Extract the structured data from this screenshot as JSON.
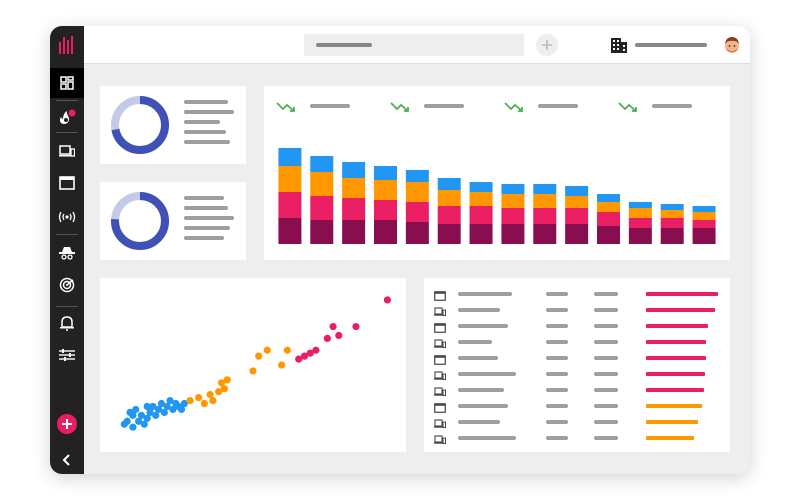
{
  "app": {
    "logo": "bar-logo-icon"
  },
  "colors": {
    "accent": "#e91e63",
    "blue": "#2196f3",
    "orange": "#ff9800",
    "pink": "#e91e63",
    "maroon": "#880e4f",
    "ring": "#3f51b5",
    "trend": "#4caf50"
  },
  "sidebar": {
    "items": [
      {
        "icon": "dashboard-icon",
        "active": true
      },
      {
        "icon": "fire-icon",
        "badge": true
      },
      {
        "icon": "devices-icon"
      },
      {
        "icon": "window-icon"
      },
      {
        "icon": "broadcast-icon"
      },
      {
        "icon": "incognito-icon"
      },
      {
        "icon": "radar-icon"
      },
      {
        "icon": "bell-icon"
      },
      {
        "icon": "sliders-icon"
      }
    ],
    "add_icon": "plus-icon",
    "collapse_icon": "chevron-left-icon"
  },
  "topbar": {
    "search_icon": "search-placeholder",
    "add_icon": "plus-icon",
    "org_icon": "building-icon",
    "avatar": "avatar-icon"
  },
  "donuts": [
    {
      "arc_fraction": 0.72
    },
    {
      "arc_fraction": 0.76
    }
  ],
  "trend_icons": [
    "trend-down-icon",
    "trend-down-icon",
    "trend-down-icon",
    "trend-down-icon"
  ],
  "chart_data": [
    {
      "type": "bar",
      "stacked": true,
      "categories": [
        "",
        "",
        "",
        "",
        "",
        "",
        "",
        "",
        "",
        "",
        "",
        "",
        "",
        ""
      ],
      "series": [
        {
          "color": "#880e4f",
          "values": [
            26,
            24,
            24,
            24,
            22,
            20,
            20,
            20,
            20,
            20,
            18,
            16,
            16,
            16
          ]
        },
        {
          "color": "#e91e63",
          "values": [
            26,
            24,
            22,
            20,
            20,
            18,
            18,
            16,
            16,
            16,
            14,
            10,
            10,
            8
          ]
        },
        {
          "color": "#ff9800",
          "values": [
            26,
            24,
            20,
            20,
            20,
            16,
            14,
            14,
            14,
            12,
            10,
            10,
            8,
            8
          ]
        },
        {
          "color": "#2196f3",
          "values": [
            18,
            16,
            16,
            14,
            12,
            12,
            10,
            10,
            10,
            10,
            8,
            6,
            6,
            6
          ]
        }
      ],
      "ylim": [
        0,
        100
      ],
      "grid": false,
      "legend": "none"
    },
    {
      "type": "scatter",
      "xlim": [
        0,
        100
      ],
      "ylim": [
        0,
        100
      ],
      "grid": false,
      "series": [
        {
          "color": "#2196f3",
          "points": [
            [
              5,
              12
            ],
            [
              6,
              14
            ],
            [
              8,
              10
            ],
            [
              8,
              18
            ],
            [
              9,
              22
            ],
            [
              10,
              14
            ],
            [
              11,
              18
            ],
            [
              12,
              12
            ],
            [
              13,
              16
            ],
            [
              14,
              20
            ],
            [
              15,
              24
            ],
            [
              16,
              18
            ],
            [
              17,
              22
            ],
            [
              18,
              26
            ],
            [
              19,
              20
            ],
            [
              20,
              24
            ],
            [
              21,
              28
            ],
            [
              22,
              22
            ],
            [
              23,
              26
            ],
            [
              24,
              24
            ],
            [
              25,
              22
            ],
            [
              26,
              26
            ],
            [
              7,
              20
            ],
            [
              13,
              24
            ]
          ]
        },
        {
          "color": "#ff9800",
          "points": [
            [
              28,
              28
            ],
            [
              31,
              30
            ],
            [
              33,
              26
            ],
            [
              35,
              32
            ],
            [
              36,
              28
            ],
            [
              38,
              34
            ],
            [
              39,
              40
            ],
            [
              40,
              36
            ],
            [
              41,
              42
            ],
            [
              50,
              48
            ],
            [
              52,
              58
            ],
            [
              55,
              62
            ],
            [
              60,
              52
            ],
            [
              62,
              62
            ]
          ]
        },
        {
          "color": "#e91e63",
          "points": [
            [
              66,
              56
            ],
            [
              68,
              58
            ],
            [
              70,
              60
            ],
            [
              72,
              62
            ],
            [
              76,
              70
            ],
            [
              78,
              78
            ],
            [
              80,
              72
            ],
            [
              86,
              78
            ],
            [
              97,
              96
            ]
          ]
        }
      ]
    }
  ],
  "device_list": {
    "rows": [
      {
        "icon": "window-icon",
        "bar_color": "#e91e63",
        "value": 100
      },
      {
        "icon": "devices-icon",
        "bar_color": "#e91e63",
        "value": 96
      },
      {
        "icon": "window-icon",
        "bar_color": "#e91e63",
        "value": 86
      },
      {
        "icon": "devices-icon",
        "bar_color": "#e91e63",
        "value": 84
      },
      {
        "icon": "window-icon",
        "bar_color": "#e91e63",
        "value": 84
      },
      {
        "icon": "devices-icon",
        "bar_color": "#e91e63",
        "value": 82
      },
      {
        "icon": "devices-icon",
        "bar_color": "#e91e63",
        "value": 80
      },
      {
        "icon": "window-icon",
        "bar_color": "#ff9800",
        "value": 78
      },
      {
        "icon": "devices-icon",
        "bar_color": "#ff9800",
        "value": 72
      },
      {
        "icon": "devices-icon",
        "bar_color": "#ff9800",
        "value": 66
      }
    ]
  }
}
